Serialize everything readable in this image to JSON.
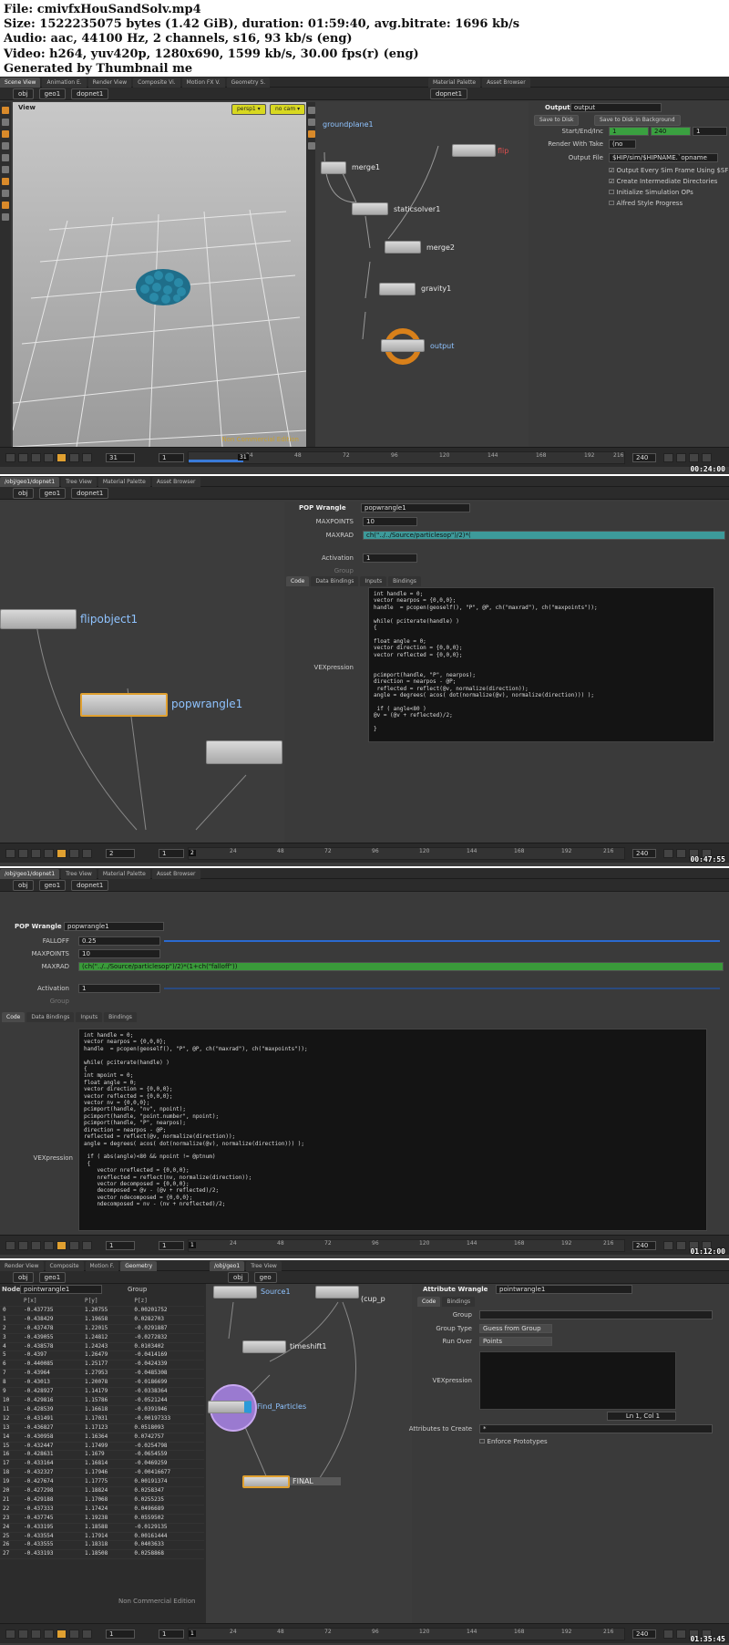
{
  "header": {
    "file": "File: cmivfxHouSandSolv.mp4",
    "size": "Size: 1522235075 bytes (1.42 GiB), duration: 01:59:40, avg.bitrate: 1696 kb/s",
    "audio": "Audio: aac, 44100 Hz, 2 channels, s16, 93 kb/s (eng)",
    "video": "Video: h264, yuv420p, 1280x690, 1599 kb/s, 30.00 fps(r) (eng)",
    "generated": "Generated by Thumbnail me"
  },
  "frame1": {
    "tabs_left": [
      "Scene View",
      "Animation E.",
      "Render View",
      "Composite Vi.",
      "Motion FX V.",
      "Geometry S."
    ],
    "tabs_right": [
      "Material Palette",
      "Asset Browser"
    ],
    "path_left": [
      "obj",
      "geo1",
      "dopnet1"
    ],
    "path_right": [
      "dopnet1"
    ],
    "view_label": "View",
    "persp": "persp1 ▾",
    "cam": "no cam ▾",
    "edition": "Non Commercial Edition",
    "nodes": {
      "groundplane": "groundplane1",
      "merge1": "merge1",
      "staticsolver": "staticsolver1",
      "merge2": "merge2",
      "gravity": "gravity1",
      "output": "output",
      "flip": "flip"
    },
    "params": {
      "type": "Output",
      "name": "output",
      "save_disk": "Save to Disk",
      "save_bg": "Save to Disk in Background",
      "start_end_label": "Start/End/Inc",
      "start": "1",
      "end": "240",
      "inc": "1",
      "render_take_label": "Render With Take",
      "render_take": "(no",
      "output_file_label": "Output File",
      "output_file": "$HIP/sim/$HIPNAME.`opname",
      "cb1": "Output Every Sim Frame Using $SF",
      "cb2": "Create Intermediate Directories",
      "cb3": "Initialize Simulation OPs",
      "cb4": "Alfred Style Progress"
    },
    "timeline": {
      "frame": "31",
      "start": "1",
      "end": "240",
      "current": "31",
      "ticks": [
        "24",
        "48",
        "72",
        "96",
        "120",
        "144",
        "168",
        "192",
        "216"
      ]
    },
    "timestamp": "00:24:00"
  },
  "frame2": {
    "tabs": [
      "/obj/geo1/dopnet1",
      "Tree View",
      "Material Palette",
      "Asset Browser"
    ],
    "path": [
      "obj",
      "geo1",
      "dopnet1"
    ],
    "nodes": {
      "flipobject": "flipobject1",
      "popwrangle": "popwrangle1"
    },
    "params": {
      "type": "POP Wrangle",
      "name": "popwrangle1",
      "maxpoints_label": "MAXPOINTS",
      "maxpoints": "10",
      "maxrad_label": "MAXRAD",
      "maxrad": "ch(\"../../Source/particlesop\")/2)*(",
      "activation_label": "Activation",
      "activation": "1",
      "group_label": "Group",
      "tabs": [
        "Code",
        "Data Bindings",
        "Inputs",
        "Bindings"
      ],
      "vex_label": "VEXpression"
    },
    "code": "int handle = 0;\nvector nearpos = {0,0,0};\nhandle  = pcopen(geoself(), \"P\", @P, ch(\"maxrad\"), ch(\"maxpoints\"));\n\nwhile( pciterate(handle) )\n{\n\nfloat angle = 0;\nvector direction = {0,0,0};\nvector reflected = {0,0,0};\n\n\npcimport(handle, \"P\", nearpos);\ndirection = nearpos - @P;\n reflected = reflect(@v, normalize(direction));\nangle = degrees( acos( dot(normalize(@v), normalize(direction))) );\n\n if ( angle<80 )\n@v = (@v + reflected)/2;\n\n}",
    "timeline": {
      "frame": "2",
      "start": "1",
      "end": "240",
      "current": "2",
      "ticks": [
        "24",
        "48",
        "72",
        "96",
        "120",
        "144",
        "168",
        "192",
        "216"
      ]
    },
    "timestamp": "00:47:55"
  },
  "frame3": {
    "tabs": [
      "/obj/geo1/dopnet1",
      "Tree View",
      "Material Palette",
      "Asset Browser"
    ],
    "path": [
      "obj",
      "geo1",
      "dopnet1"
    ],
    "params": {
      "type": "POP Wrangle",
      "name": "popwrangle1",
      "falloff_label": "FALLOFF",
      "falloff": "0.25",
      "maxpoints_label": "MAXPOINTS",
      "maxpoints": "10",
      "maxrad_label": "MAXRAD",
      "maxrad": "(ch(\"../../Source/particlesop\")/2)*(1+ch(\"falloff\"))",
      "activation_label": "Activation",
      "activation": "1",
      "group_label": "Group",
      "tabs": [
        "Code",
        "Data Bindings",
        "Inputs",
        "Bindings"
      ],
      "vex_label": "VEXpression"
    },
    "code": "int handle = 0;\nvector nearpos = {0,0,0};\nhandle  = pcopen(geoself(), \"P\", @P, ch(\"maxrad\"), ch(\"maxpoints\"));\n\nwhile( pciterate(handle) )\n{\nint mpoint = 0;\nfloat angle = 0;\nvector direction = {0,0,0};\nvector reflected = {0,0,0};\nvector nv = {0,0,0};\npcimport(handle, \"nv\", npoint);\npcimport(handle, \"point.number\", npoint);\npcimport(handle, \"P\", nearpos);\ndirection = nearpos - @P;\nreflected = reflect(@v, normalize(direction));\nangle = degrees( acos( dot(normalize(@v), normalize(direction))) );\n\n if ( abs(angle)<80 && npoint != @ptnum)\n {\n    vector nreflected = {0,0,0};\n    nreflected = reflect(nv, normalize(direction));\n    vector decomposed = {0,0,0};\n    decomposed = @v - (@v + reflected)/2;\n    vector ndecomposed = {0,0,0};\n    ndecomposed = nv - (nv + nreflected)/2;",
    "timeline": {
      "frame": "1",
      "start": "1",
      "end": "240",
      "current": "1",
      "ticks": [
        "24",
        "48",
        "72",
        "96",
        "120",
        "144",
        "168",
        "192",
        "216"
      ]
    },
    "timestamp": "01:12:00"
  },
  "frame4": {
    "tabs_left": [
      "Render View",
      "Composite",
      "Motion F.",
      "Geometry"
    ],
    "tabs_right": [
      "/obj/geo1",
      "Tree View"
    ],
    "path_left": [
      "obj",
      "geo1"
    ],
    "path_right": [
      "obj",
      "geo"
    ],
    "node_label": "Node",
    "node_name": "pointwrangle1",
    "group_label": "Group",
    "columns": [
      "",
      "P[x]",
      "P[y]",
      "P[z]"
    ],
    "rows": [
      [
        "0",
        "-0.437735",
        "1.20755",
        "0.00201752"
      ],
      [
        "1",
        "-0.438429",
        "1.19658",
        "0.0282703"
      ],
      [
        "2",
        "-0.437478",
        "1.22015",
        "-0.0291887"
      ],
      [
        "3",
        "-0.439055",
        "1.24812",
        "-0.0272832"
      ],
      [
        "4",
        "-0.438578",
        "1.24243",
        "0.0103402"
      ],
      [
        "5",
        "-0.4397",
        "1.26479",
        "-0.0414169"
      ],
      [
        "6",
        "-0.440085",
        "1.25177",
        "-0.0424339"
      ],
      [
        "7",
        "-0.43964",
        "1.27953",
        "-0.0485308"
      ],
      [
        "8",
        "-0.43013",
        "1.20078",
        "-0.0186699"
      ],
      [
        "9",
        "-0.428927",
        "1.14179",
        "-0.0338364"
      ],
      [
        "10",
        "-0.429816",
        "1.15786",
        "-0.0521244"
      ],
      [
        "11",
        "-0.428539",
        "1.16618",
        "-0.0391946"
      ],
      [
        "12",
        "-0.431491",
        "1.17031",
        "-0.00197333"
      ],
      [
        "13",
        "-0.436827",
        "1.17123",
        "0.0518093"
      ],
      [
        "14",
        "-0.430958",
        "1.16364",
        "0.0742757"
      ],
      [
        "15",
        "-0.432447",
        "1.17499",
        "-0.0254798"
      ],
      [
        "16",
        "-0.428631",
        "1.1679",
        "-0.0654559"
      ],
      [
        "17",
        "-0.433164",
        "1.16814",
        "-0.0469259"
      ],
      [
        "18",
        "-0.432327",
        "1.17946",
        "-0.00416677"
      ],
      [
        "19",
        "-0.427674",
        "1.17775",
        "0.00191374"
      ],
      [
        "20",
        "-0.427298",
        "1.18824",
        "0.0258347"
      ],
      [
        "21",
        "-0.429188",
        "1.17068",
        "0.0255235"
      ],
      [
        "22",
        "-0.437333",
        "1.17424",
        "0.0496689"
      ],
      [
        "23",
        "-0.437745",
        "1.19238",
        "0.0559502"
      ],
      [
        "24",
        "-0.433195",
        "1.18588",
        "-0.0129135"
      ],
      [
        "25",
        "-0.433554",
        "1.17914",
        "0.00161444"
      ],
      [
        "26",
        "-0.433555",
        "1.18318",
        "0.0403633"
      ],
      [
        "27",
        "-0.433193",
        "1.18508",
        "0.0258868"
      ]
    ],
    "nodes": {
      "source": "Source1",
      "cup": "(cup_p",
      "timeshift": "timeshift1",
      "find": "Find_Particles",
      "final": "FINAL"
    },
    "params": {
      "type": "Attribute Wrangle",
      "name": "pointwrangle1",
      "tabs": [
        "Code",
        "Bindings"
      ],
      "group_label": "Group",
      "group_type_label": "Group Type",
      "group_type": "Guess from Group",
      "run_over_label": "Run Over",
      "run_over": "Points",
      "vex_label": "VEXpression",
      "cursor": "Ln 1, Col 1",
      "attrs_label": "Attributes to Create",
      "attrs": "*",
      "enforce": "Enforce Prototypes"
    },
    "edition": "Non Commercial Edition",
    "timeline": {
      "frame": "1",
      "start": "1",
      "end": "240",
      "current": "1",
      "ticks": [
        "24",
        "48",
        "72",
        "96",
        "120",
        "144",
        "168",
        "192",
        "216"
      ]
    },
    "timestamp": "01:35:45"
  },
  "colors": {
    "houdini_orange": "#e0a030",
    "selection_blue": "#8fc3ff",
    "vex_teal": "#3d9a9a",
    "maxrad_green": "#3a9a3a"
  }
}
